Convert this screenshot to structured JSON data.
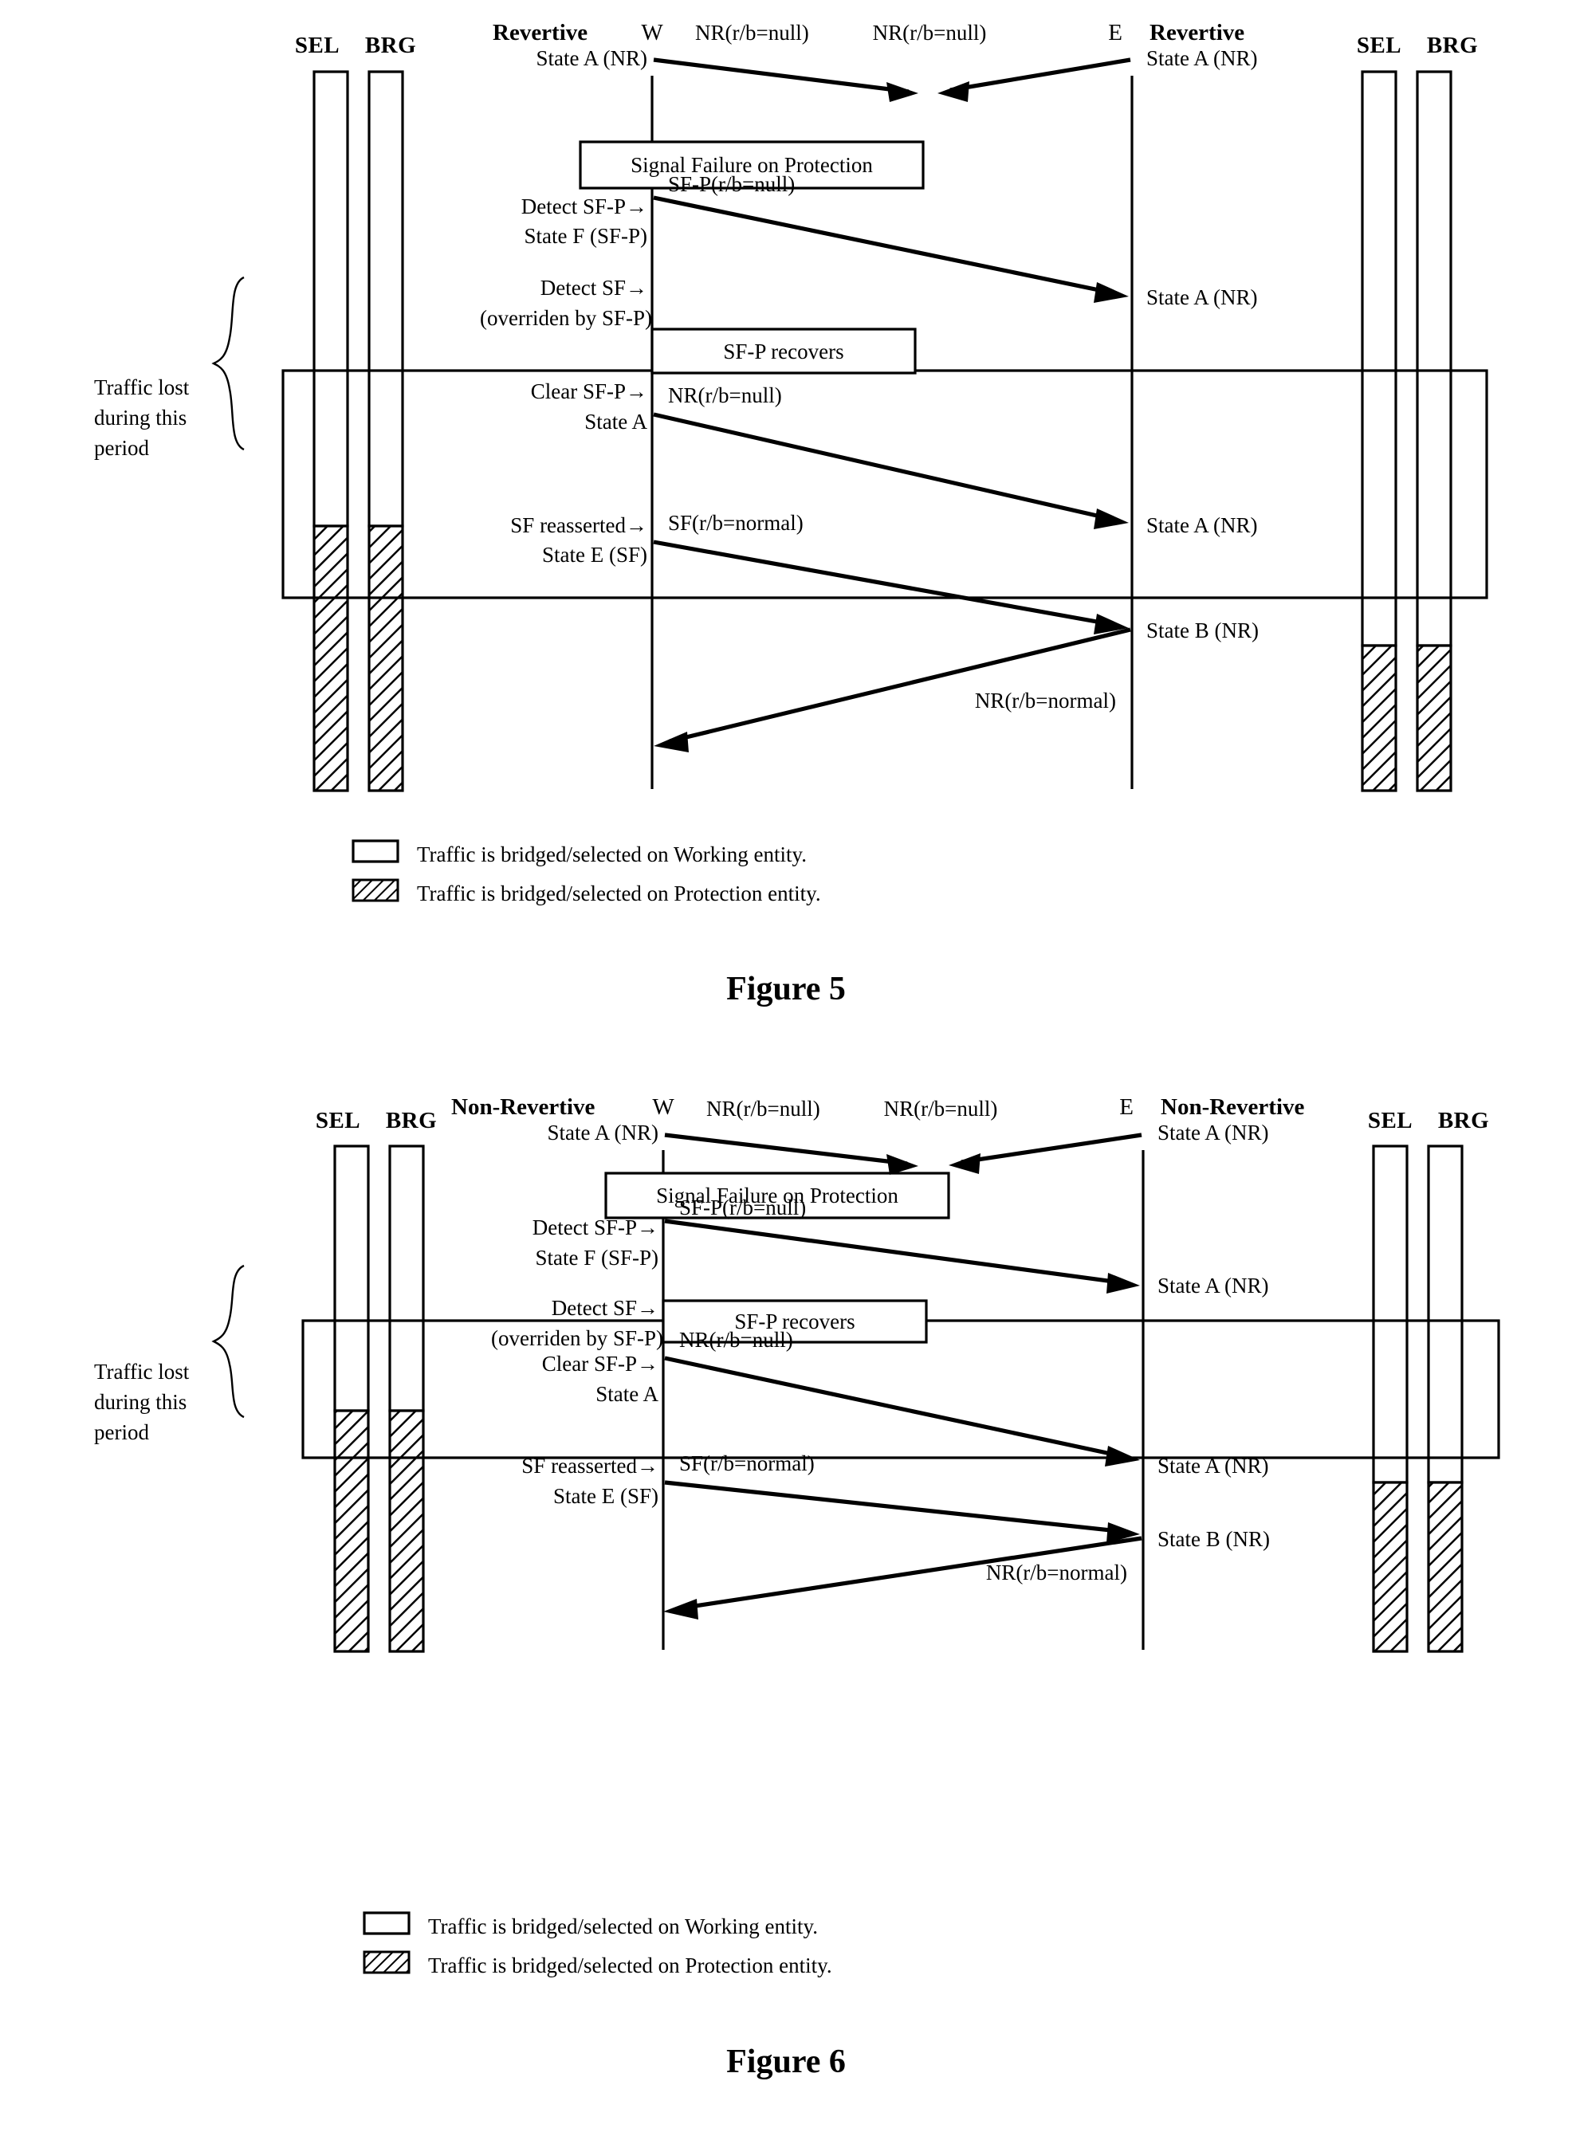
{
  "page": {
    "figures": [
      {
        "id": "figure5",
        "caption": "Figure 5",
        "mode_left": "Revertive",
        "mode_right": "Revertive",
        "lifeline_left_label": "W",
        "lifeline_right_label": "E",
        "col_headers_left": {
          "sel": "SEL",
          "brg": "BRG"
        },
        "col_headers_right": {
          "sel": "SEL",
          "brg": "BRG"
        },
        "brace_label_lines": [
          "Traffic lost",
          "during this",
          "period"
        ],
        "left_states": [
          "State A (NR)",
          "Detect SF-P→",
          "State F (SF-P)",
          "Detect SF→",
          "(overriden by SF-P)",
          "Clear SF-P→",
          "State A",
          "SF reasserted→",
          "State E (SF)"
        ],
        "right_states": [
          "State A (NR)",
          "State A (NR)",
          "State A (NR)",
          "State B (NR)"
        ],
        "event_boxes": [
          "Signal Failure on Protection",
          "SF-P recovers"
        ],
        "messages": [
          "NR(r/b=null)",
          "NR(r/b=null)",
          "SF-P(r/b=null)",
          "NR(r/b=null)",
          "SF(r/b=normal)",
          "NR(r/b=normal)"
        ],
        "legend": [
          {
            "pattern": "plain",
            "text": "Traffic is bridged/selected on Working entity."
          },
          {
            "pattern": "hatched",
            "text": "Traffic is bridged/selected on Protection entity."
          }
        ]
      },
      {
        "id": "figure6",
        "caption": "Figure 6",
        "mode_left": "Non-Revertive",
        "mode_right": "Non-Revertive",
        "lifeline_left_label": "W",
        "lifeline_right_label": "E",
        "col_headers_left": {
          "sel": "SEL",
          "brg": "BRG"
        },
        "col_headers_right": {
          "sel": "SEL",
          "brg": "BRG"
        },
        "brace_label_lines": [
          "Traffic lost",
          "during this",
          "period"
        ],
        "left_states": [
          "State A (NR)",
          "Detect SF-P→",
          "State F (SF-P)",
          "Detect SF→",
          "(overriden by SF-P)",
          "Clear SF-P→",
          "State A",
          "SF reasserted→",
          "State E (SF)"
        ],
        "right_states": [
          "State A (NR)",
          "State A (NR)",
          "State A (NR)",
          "State B (NR)"
        ],
        "event_boxes": [
          "Signal Failure on Protection",
          "SF-P recovers"
        ],
        "messages": [
          "NR(r/b=null)",
          "NR(r/b=null)",
          "SF-P(r/b=null)",
          "NR(r/b=null)",
          "SF(r/b=normal)",
          "NR(r/b=normal)"
        ],
        "legend": [
          {
            "pattern": "plain",
            "text": "Traffic is bridged/selected on Working entity."
          },
          {
            "pattern": "hatched",
            "text": "Traffic is bridged/selected on Protection entity."
          }
        ]
      }
    ],
    "colors": {
      "ink": "#000000",
      "paper": "#ffffff"
    }
  }
}
